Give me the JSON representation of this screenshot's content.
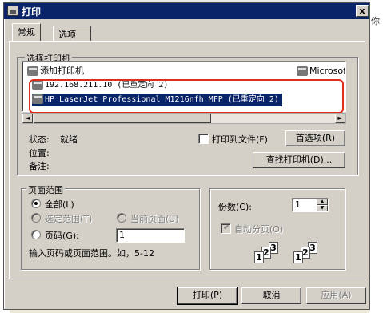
{
  "background": {
    "right_text": "你"
  },
  "dialog": {
    "title": "打印",
    "close_label": "x",
    "tabs": [
      {
        "label": "常规"
      },
      {
        "label": "选项"
      }
    ]
  },
  "select_printer": {
    "group_label": "选择打印机",
    "items": [
      {
        "label": "添加打印机"
      },
      {
        "label": "Microsof"
      },
      {
        "label": "192.168.211.10 (已重定向 2)"
      },
      {
        "label": "HP LaserJet Professional M1216nfh MFP (已重定向 2)",
        "selected": true
      }
    ],
    "scroll_left": "◄",
    "scroll_right": "►",
    "status_label": "状态:",
    "status_value": "就绪",
    "location_label": "位置:",
    "comment_label": "备注:",
    "print_to_file_label": "打印到文件(F)",
    "preferences_button": "首选项(R)",
    "find_printer_button": "查找打印机(D)..."
  },
  "page_range": {
    "group_label": "页面范围",
    "all_label": "全部(L)",
    "selection_label": "选定范围(T)",
    "current_page_label": "当前页面(U)",
    "pages_label": "页码(G):",
    "pages_value": "1",
    "hint": "输入页码或页面范围。如，5-12"
  },
  "copies": {
    "label": "份数(C):",
    "value": "1",
    "collate_label": "自动分页(O)",
    "collate_checked": true,
    "page_numbers": [
      "1",
      "2",
      "3"
    ],
    "spin_up": "▲",
    "spin_down": "▼"
  },
  "buttons": {
    "print": "打印(P)",
    "cancel": "取消",
    "apply": "应用(A)"
  },
  "colors": {
    "dialog_bg": "#d4d0c8",
    "titlebar": "#0a246a",
    "selection": "#0a246a",
    "highlight_annotation": "#e02d1a"
  }
}
